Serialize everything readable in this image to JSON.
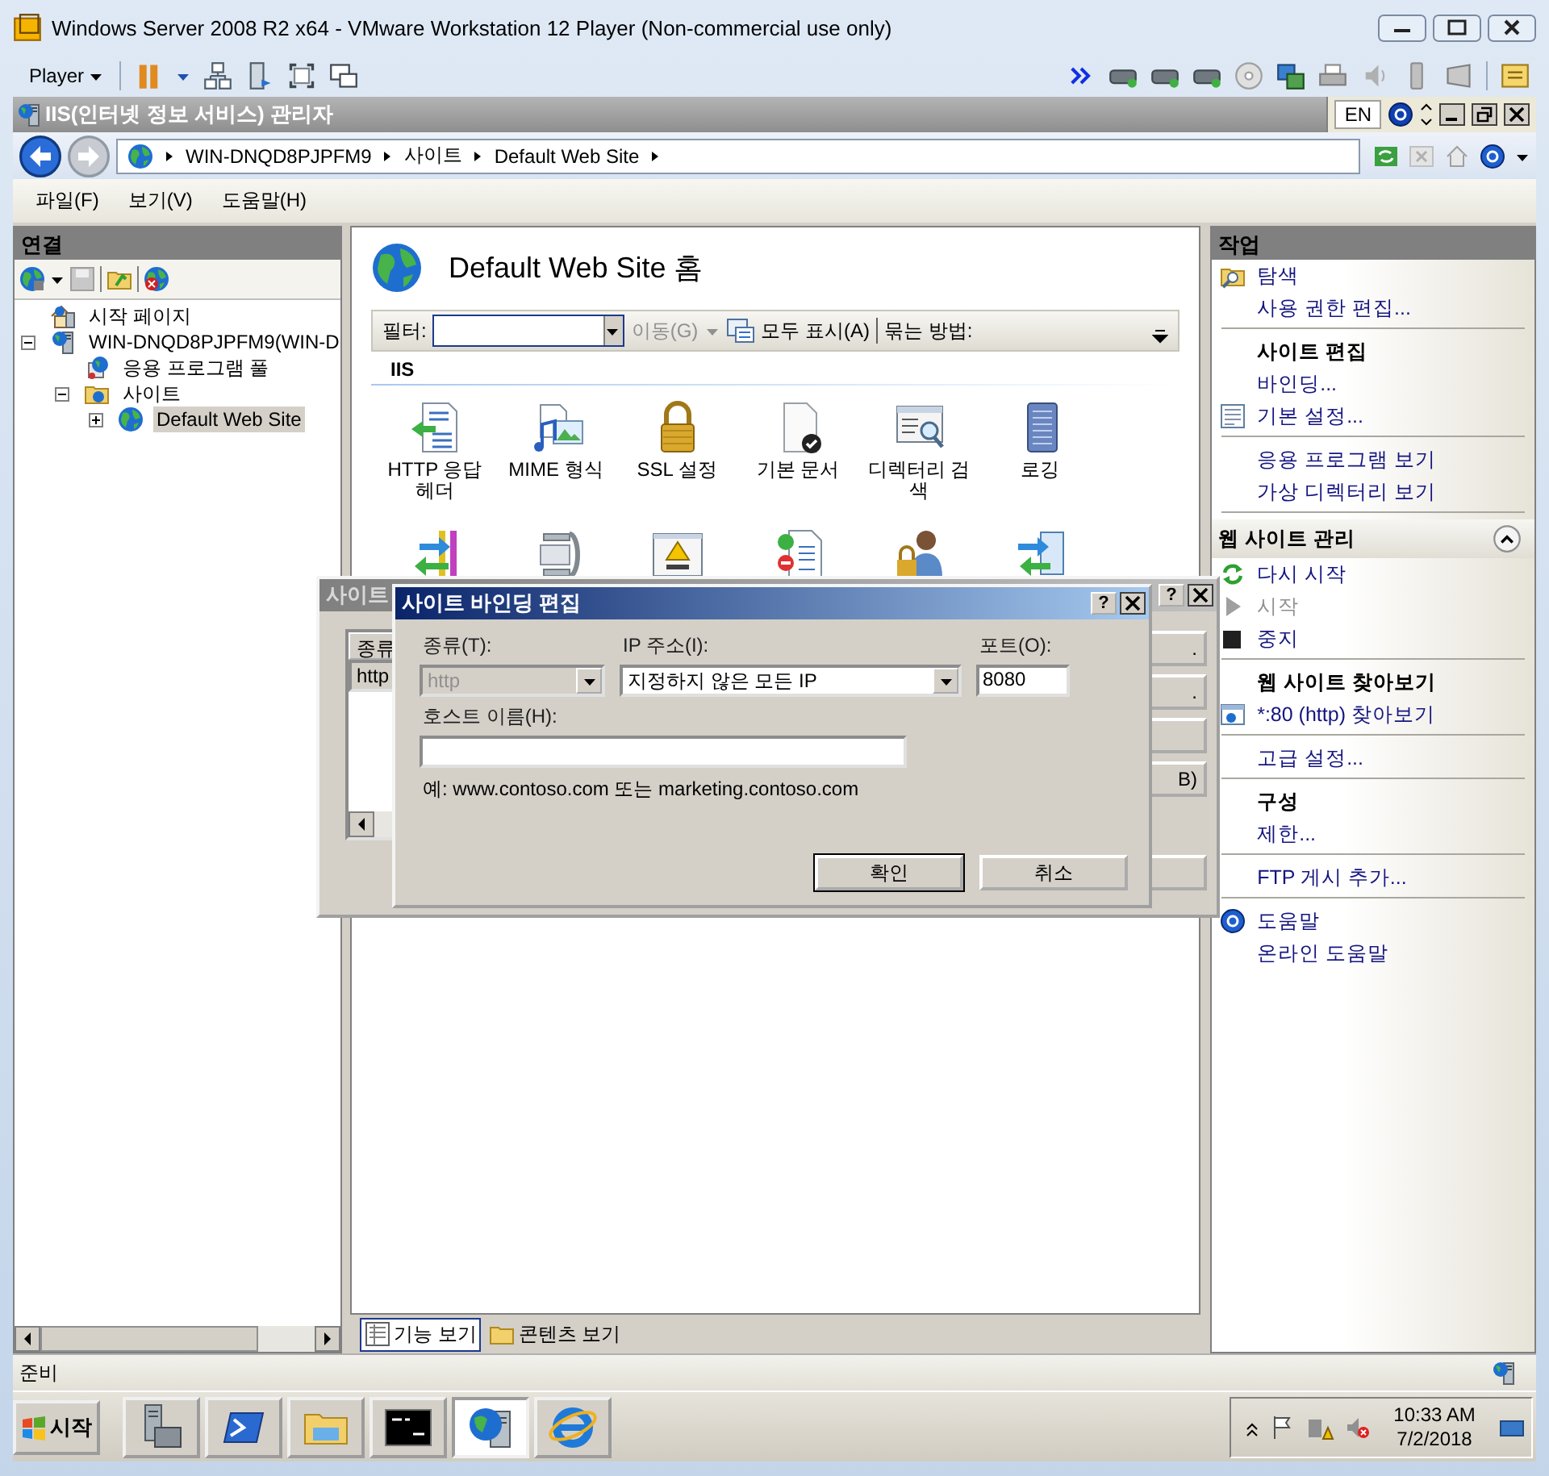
{
  "vmware": {
    "title": "Windows Server 2008 R2 x64 - VMware Workstation 12 Player (Non-commercial use only)",
    "player_menu": "Player"
  },
  "iis": {
    "title": "IIS(인터넷 정보 서비스) 관리자",
    "language": "EN"
  },
  "address_bar": {
    "crumbs": [
      "WIN-DNQD8PJPFM9",
      "사이트",
      "Default Web Site"
    ]
  },
  "menu": [
    "파일(F)",
    "보기(V)",
    "도움말(H)"
  ],
  "connections": {
    "title": "연결",
    "tree": [
      {
        "kind": "start-page",
        "label": "시작 페이지",
        "selected": false
      },
      {
        "kind": "server",
        "label": "WIN-DNQD8PJPFM9(WIN-D",
        "selected": false,
        "expanded": true,
        "children": [
          {
            "kind": "app-pools",
            "label": "응용 프로그램 풀",
            "selected": false
          },
          {
            "kind": "sites",
            "label": "사이트",
            "selected": false,
            "expanded": true,
            "children": [
              {
                "kind": "site",
                "label": "Default Web Site",
                "selected": true,
                "expanded": false
              }
            ]
          }
        ]
      }
    ]
  },
  "content": {
    "title": "Default Web Site 홈",
    "filter": {
      "label": "필터:",
      "go": "이동(G)",
      "show_all": "모두 표시(A)",
      "group_by": "묶는 방법:"
    },
    "group": "IIS",
    "features": [
      {
        "kind": "http-headers",
        "label": "HTTP 응답 헤더"
      },
      {
        "kind": "mime",
        "label": "MIME 형식"
      },
      {
        "kind": "ssl",
        "label": "SSL 설정"
      },
      {
        "kind": "default-doc",
        "label": "기본 문서"
      },
      {
        "kind": "dir-browse",
        "label": "디렉터리 검색"
      },
      {
        "kind": "logging",
        "label": "로깅"
      },
      {
        "kind": "handlers"
      },
      {
        "kind": "compression"
      },
      {
        "kind": "error-pages"
      },
      {
        "kind": "authorization"
      },
      {
        "kind": "authentication"
      },
      {
        "kind": "redirect"
      }
    ],
    "view_tabs": [
      {
        "label": "기능 보기",
        "selected": true
      },
      {
        "label": "콘텐츠 보기",
        "selected": false
      }
    ]
  },
  "actions": {
    "title": "작업",
    "groups": [
      {
        "items": [
          {
            "kind": "explore",
            "text": "탐색",
            "disabled": false
          },
          {
            "kind": "link",
            "text": "사용 권한 편집...",
            "disabled": false
          }
        ]
      },
      {
        "items": [
          {
            "kind": "heading",
            "text": "사이트 편집"
          },
          {
            "kind": "link",
            "text": "바인딩...",
            "disabled": false
          },
          {
            "kind": "settings",
            "text": "기본 설정...",
            "disabled": false
          }
        ]
      },
      {
        "items": [
          {
            "kind": "link",
            "text": "응용 프로그램 보기",
            "disabled": false
          },
          {
            "kind": "link",
            "text": "가상 디렉터리 보기",
            "disabled": false
          }
        ]
      },
      {
        "items": [
          {
            "kind": "panel",
            "text": "웹 사이트 관리",
            "expanded": true
          },
          {
            "kind": "restart",
            "text": "다시 시작",
            "disabled": false
          },
          {
            "kind": "start",
            "text": "시작",
            "disabled": true
          },
          {
            "kind": "stop",
            "text": "중지",
            "disabled": false
          }
        ]
      },
      {
        "items": [
          {
            "kind": "heading",
            "text": "웹 사이트 찾아보기"
          },
          {
            "kind": "browse",
            "text": "*:80 (http) 찾아보기",
            "disabled": false
          }
        ]
      },
      {
        "items": [
          {
            "kind": "link",
            "text": "고급 설정...",
            "disabled": false
          }
        ]
      },
      {
        "items": [
          {
            "kind": "heading",
            "text": "구성"
          },
          {
            "kind": "link",
            "text": "제한...",
            "disabled": false
          }
        ]
      },
      {
        "items": [
          {
            "kind": "link",
            "text": "FTP 게시 추가...",
            "disabled": false
          }
        ]
      },
      {
        "items": [
          {
            "kind": "help",
            "text": "도움말",
            "disabled": false
          },
          {
            "kind": "link",
            "text": "온라인 도움말",
            "disabled": false
          }
        ]
      }
    ]
  },
  "status_bar": "준비",
  "taskbar": {
    "start": "시작",
    "apps": [
      {
        "kind": "server-manager",
        "selected": false
      },
      {
        "kind": "powershell",
        "selected": false
      },
      {
        "kind": "explorer",
        "selected": false
      },
      {
        "kind": "cmd",
        "selected": false
      },
      {
        "kind": "iis",
        "selected": true
      },
      {
        "kind": "ie",
        "selected": false
      }
    ],
    "time": "10:33 AM",
    "date": "7/2/2018"
  },
  "bindings_dialog": {
    "title": "사이트",
    "help_button": "?",
    "columns": [
      "종류"
    ],
    "rows": [
      {
        "cells": [
          "http"
        ],
        "selected": true
      }
    ],
    "buttons": [
      {
        "kind": "text",
        "label": "."
      },
      {
        "kind": "text",
        "label": "."
      },
      {
        "kind": "blank"
      },
      {
        "kind": "text",
        "label": "B)"
      },
      {
        "kind": "blank"
      }
    ]
  },
  "edit_dialog": {
    "title": "사이트 바인딩 편집",
    "help_button": "?",
    "type": {
      "label": "종류(T):",
      "value": "http",
      "disabled": true
    },
    "ip": {
      "label": "IP 주소(I):",
      "value": "지정하지 않은 모든 IP"
    },
    "port": {
      "label": "포트(O):",
      "value": "8080"
    },
    "host": {
      "label": "호스트 이름(H):"
    },
    "example": "예: www.contoso.com 또는 marketing.contoso.com",
    "buttons": [
      {
        "label": "확인",
        "default": true
      },
      {
        "label": "취소",
        "default": false
      }
    ]
  }
}
